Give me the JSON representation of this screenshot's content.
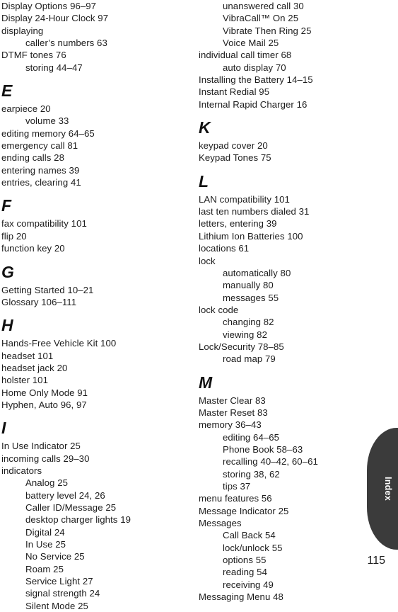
{
  "page": {
    "number": "115",
    "tab_label": "Index"
  },
  "columns": [
    {
      "id": "left",
      "blocks": [
        {
          "type": "entries",
          "continued": true,
          "entries": [
            {
              "text": "Display Options 96–97",
              "level": 0
            },
            {
              "text": "Display 24-Hour Clock 97",
              "level": 0
            },
            {
              "text": "displaying",
              "level": 0
            },
            {
              "text": "caller’s numbers 63",
              "level": 1
            },
            {
              "text": "DTMF tones 76",
              "level": 0
            },
            {
              "text": "storing 44–47",
              "level": 1
            }
          ]
        },
        {
          "type": "letter",
          "letter": "E",
          "entries": [
            {
              "text": "earpiece 20",
              "level": 0
            },
            {
              "text": "volume 33",
              "level": 1
            },
            {
              "text": "editing memory 64–65",
              "level": 0
            },
            {
              "text": "emergency call 81",
              "level": 0
            },
            {
              "text": "ending calls 28",
              "level": 0
            },
            {
              "text": "entering names 39",
              "level": 0
            },
            {
              "text": "entries, clearing 41",
              "level": 0
            }
          ]
        },
        {
          "type": "letter",
          "letter": "F",
          "entries": [
            {
              "text": "fax compatibility 101",
              "level": 0
            },
            {
              "text": "flip 20",
              "level": 0
            },
            {
              "text": "function key 20",
              "level": 0
            }
          ]
        },
        {
          "type": "letter",
          "letter": "G",
          "entries": [
            {
              "text": "Getting Started 10–21",
              "level": 0
            },
            {
              "text": "Glossary 106–111",
              "level": 0
            }
          ]
        },
        {
          "type": "letter",
          "letter": "H",
          "entries": [
            {
              "text": "Hands-Free Vehicle Kit 100",
              "level": 0
            },
            {
              "text": "headset 101",
              "level": 0
            },
            {
              "text": "headset jack 20",
              "level": 0
            },
            {
              "text": "holster 101",
              "level": 0
            },
            {
              "text": "Home Only Mode 91",
              "level": 0
            },
            {
              "text": "Hyphen, Auto 96, 97",
              "level": 0
            }
          ]
        },
        {
          "type": "letter",
          "letter": "I",
          "entries": [
            {
              "text": "In Use Indicator 25",
              "level": 0
            },
            {
              "text": "incoming calls 29–30",
              "level": 0
            },
            {
              "text": "indicators",
              "level": 0
            },
            {
              "text": "Analog 25",
              "level": 1
            },
            {
              "text": "battery level 24, 26",
              "level": 1
            },
            {
              "text": "Caller ID/Message 25",
              "level": 1
            },
            {
              "text": "desktop charger lights 19",
              "level": 1
            },
            {
              "text": "Digital 24",
              "level": 1
            },
            {
              "text": "In Use 25",
              "level": 1
            },
            {
              "text": "No Service 25",
              "level": 1
            },
            {
              "text": "Roam 25",
              "level": 1
            },
            {
              "text": "Service Light 27",
              "level": 1
            },
            {
              "text": "signal strength 24",
              "level": 1
            },
            {
              "text": "Silent Mode 25",
              "level": 1
            }
          ]
        }
      ]
    },
    {
      "id": "right",
      "blocks": [
        {
          "type": "entries",
          "continued": true,
          "entries": [
            {
              "text": "unanswered call 30",
              "level": 1
            },
            {
              "text": "VibraCall™ On 25",
              "level": 1
            },
            {
              "text": "Vibrate Then Ring 25",
              "level": 1
            },
            {
              "text": "Voice Mail 25",
              "level": 1
            },
            {
              "text": "individual call timer 68",
              "level": 0
            },
            {
              "text": "auto display 70",
              "level": 1
            },
            {
              "text": "Installing the Battery 14–15",
              "level": 0
            },
            {
              "text": "Instant Redial 95",
              "level": 0
            },
            {
              "text": "Internal Rapid Charger 16",
              "level": 0
            }
          ]
        },
        {
          "type": "letter",
          "letter": "K",
          "entries": [
            {
              "text": "keypad cover 20",
              "level": 0
            },
            {
              "text": "Keypad Tones 75",
              "level": 0
            }
          ]
        },
        {
          "type": "letter",
          "letter": "L",
          "entries": [
            {
              "text": "LAN compatibility 101",
              "level": 0
            },
            {
              "text": "last ten numbers dialed 31",
              "level": 0
            },
            {
              "text": "letters, entering 39",
              "level": 0
            },
            {
              "text": "Lithium Ion Batteries 100",
              "level": 0
            },
            {
              "text": "locations 61",
              "level": 0
            },
            {
              "text": "lock",
              "level": 0
            },
            {
              "text": "automatically 80",
              "level": 1
            },
            {
              "text": "manually 80",
              "level": 1
            },
            {
              "text": "messages 55",
              "level": 1
            },
            {
              "text": "lock code",
              "level": 0
            },
            {
              "text": "changing 82",
              "level": 1
            },
            {
              "text": "viewing 82",
              "level": 1
            },
            {
              "text": "Lock/Security 78–85",
              "level": 0
            },
            {
              "text": "road map 79",
              "level": 1
            }
          ]
        },
        {
          "type": "letter",
          "letter": "M",
          "entries": [
            {
              "text": "Master Clear 83",
              "level": 0
            },
            {
              "text": "Master Reset 83",
              "level": 0
            },
            {
              "text": "memory 36–43",
              "level": 0
            },
            {
              "text": "editing 64–65",
              "level": 1
            },
            {
              "text": "Phone Book 58–63",
              "level": 1
            },
            {
              "text": "recalling 40–42, 60–61",
              "level": 1
            },
            {
              "text": "storing 38, 62",
              "level": 1
            },
            {
              "text": "tips 37",
              "level": 1
            },
            {
              "text": "menu features 56",
              "level": 0
            },
            {
              "text": "Message Indicator 25",
              "level": 0
            },
            {
              "text": "Messages",
              "level": 0
            },
            {
              "text": "Call Back 54",
              "level": 1
            },
            {
              "text": "lock/unlock 55",
              "level": 1
            },
            {
              "text": "options 55",
              "level": 1
            },
            {
              "text": "reading 54",
              "level": 1
            },
            {
              "text": "receiving 49",
              "level": 1
            },
            {
              "text": "Messaging Menu 48",
              "level": 0
            }
          ]
        }
      ]
    }
  ]
}
